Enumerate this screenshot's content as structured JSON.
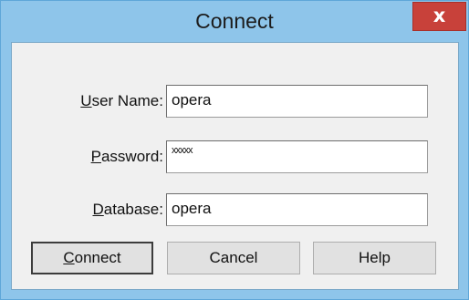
{
  "dialog": {
    "title": "Connect",
    "close_label": "x"
  },
  "form": {
    "user_name": {
      "label_accel": "U",
      "label_rest": "ser Name:",
      "value": "opera"
    },
    "password": {
      "label_accel": "P",
      "label_rest": "assword:",
      "value": "xxxxx"
    },
    "database": {
      "label_accel": "D",
      "label_rest": "atabase:",
      "value": "opera"
    }
  },
  "buttons": {
    "connect_accel": "C",
    "connect_rest": "onnect",
    "cancel": "Cancel",
    "help": "Help"
  },
  "colors": {
    "frame": "#8ec5ea",
    "close": "#c8413a",
    "client": "#f0f0f0"
  }
}
